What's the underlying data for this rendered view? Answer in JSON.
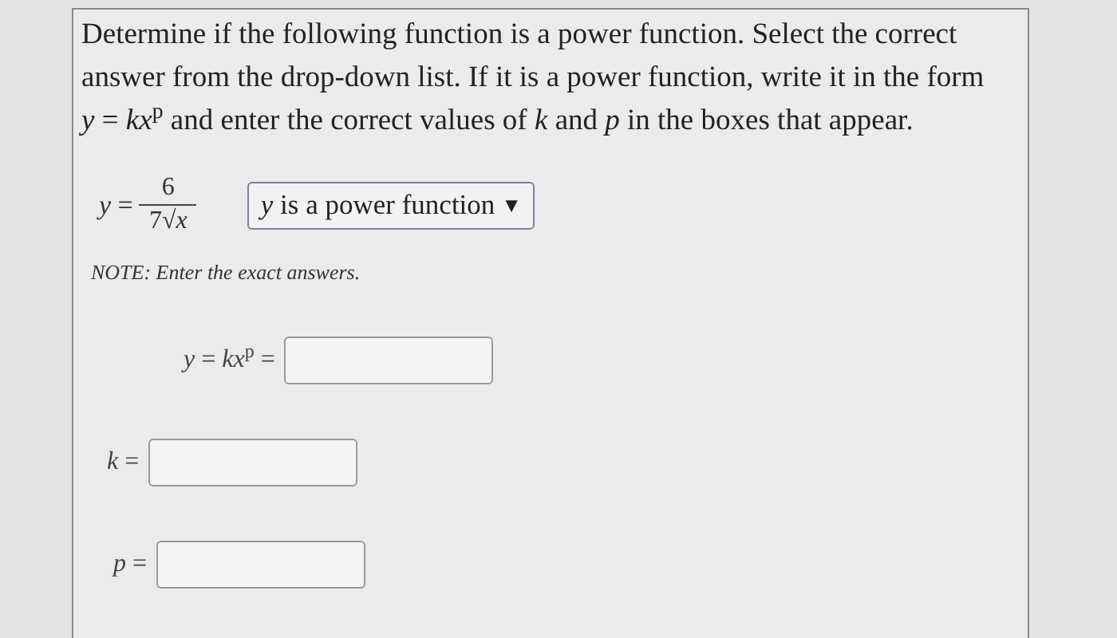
{
  "question": {
    "prompt": "Determine if the following function is a power function.  Select the correct answer from the drop-down list.  If it is a power function, write it in the form *y* = *kx*$^{p}$ and enter the correct values of *k* and *p* in the boxes that appear.",
    "equation": {
      "lhs": "*y* =",
      "numerator": "6",
      "denominator": "7√*x*"
    },
    "dropdown": {
      "value": "*y* is a power function",
      "arrow": "▼"
    },
    "note": "NOTE: Enter the exact answers.",
    "answers": [
      {
        "label": "*y* = *kx*$^{p}$ ="
      },
      {
        "label": "*k* ="
      },
      {
        "label": "*p* ="
      }
    ]
  }
}
